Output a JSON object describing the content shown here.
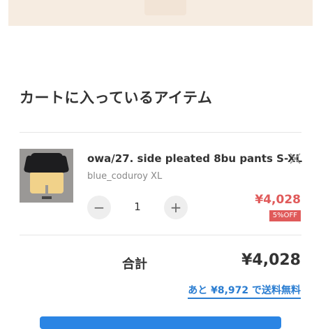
{
  "cart": {
    "heading": "カートに入っているアイテム",
    "item": {
      "name": "owa/27. side pleated 8bu pants S-XL",
      "variant": "blue_coduroy XL",
      "quantity": "1",
      "price": "¥4,028",
      "discount_badge": "5%OFF",
      "thumbnail_icon": "product-photo-black-top-yellow-shorts"
    },
    "total": {
      "label": "合計",
      "value": "¥4,028"
    },
    "free_shipping_note": "あと ¥8,972 で送料無料"
  },
  "controls": {
    "minus_symbol": "−",
    "plus_symbol": "+",
    "remove_icon": "close-icon"
  },
  "colors": {
    "accent_blue": "#2a7dd1",
    "price_red": "#e05a5a",
    "banner_beige": "#f6ece1"
  }
}
